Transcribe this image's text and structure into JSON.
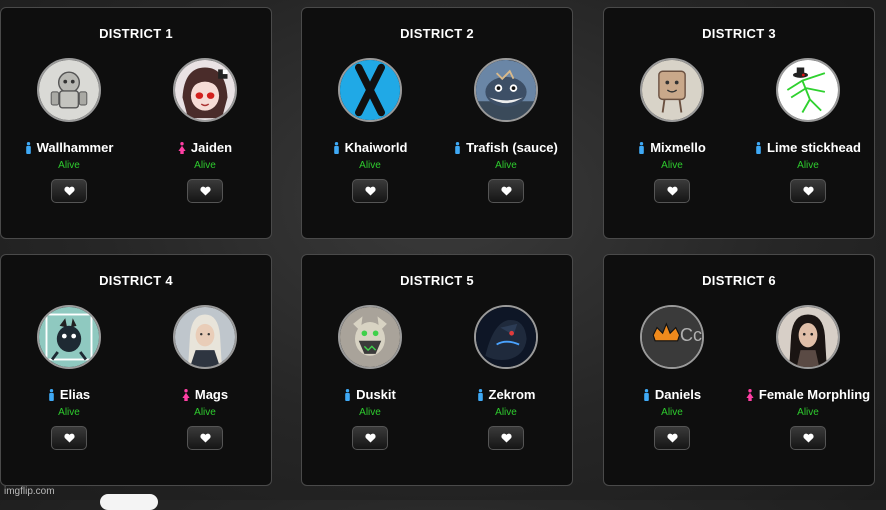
{
  "districts": [
    {
      "title": "DISTRICT 1",
      "tributes": [
        {
          "name": "Wallhammer",
          "gender": "male",
          "status": "Alive",
          "avatar": "robot-avatar"
        },
        {
          "name": "Jaiden",
          "gender": "female",
          "status": "Alive",
          "avatar": "anime-girl-avatar"
        }
      ]
    },
    {
      "title": "DISTRICT 2",
      "tributes": [
        {
          "name": "Khaiworld",
          "gender": "male",
          "status": "Alive",
          "avatar": "x-logo-avatar"
        },
        {
          "name": "Trafish (sauce)",
          "gender": "male",
          "status": "Alive",
          "avatar": "fish-avatar"
        }
      ]
    },
    {
      "title": "DISTRICT 3",
      "tributes": [
        {
          "name": "Mixmello",
          "gender": "male",
          "status": "Alive",
          "avatar": "marshmallow-avatar"
        },
        {
          "name": "Lime stickhead",
          "gender": "male",
          "status": "Alive",
          "avatar": "stickman-avatar"
        }
      ]
    },
    {
      "title": "DISTRICT 4",
      "tributes": [
        {
          "name": "Elias",
          "gender": "male",
          "status": "Alive",
          "avatar": "creature-avatar"
        },
        {
          "name": "Mags",
          "gender": "female",
          "status": "Alive",
          "avatar": "woman-avatar"
        }
      ]
    },
    {
      "title": "DISTRICT 5",
      "tributes": [
        {
          "name": "Duskit",
          "gender": "male",
          "status": "Alive",
          "avatar": "ghost-pokemon-avatar"
        },
        {
          "name": "Zekrom",
          "gender": "male",
          "status": "Alive",
          "avatar": "dragon-avatar"
        }
      ]
    },
    {
      "title": "DISTRICT 6",
      "tributes": [
        {
          "name": "Daniels",
          "gender": "male",
          "status": "Alive",
          "avatar": "crown-logo-avatar",
          "avatar_text": "Cc"
        },
        {
          "name": "Female Morphling",
          "gender": "female",
          "status": "Alive",
          "avatar": "dark-hair-woman-avatar"
        }
      ]
    }
  ],
  "colors": {
    "alive": "#2ecc2e",
    "male": "#3fa9f5",
    "female": "#ff3fa4",
    "heart": "#ffffff"
  },
  "icons": {
    "heart": "heart-icon",
    "male": "male-icon",
    "female": "female-icon"
  },
  "watermark": "imgflip.com"
}
